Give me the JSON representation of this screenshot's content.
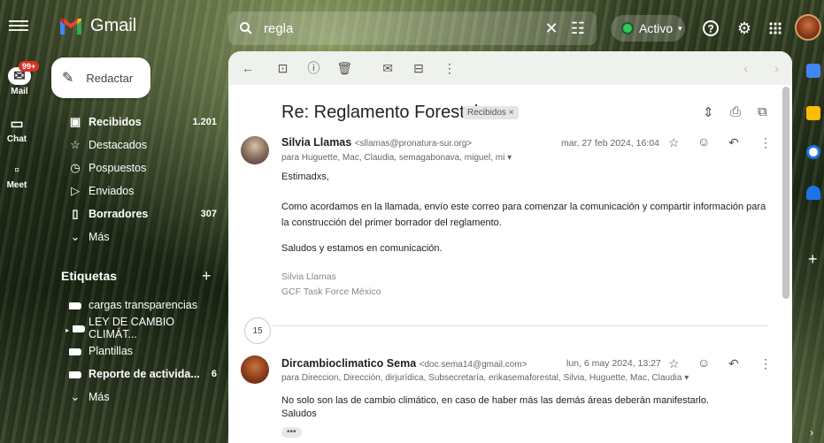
{
  "app": {
    "name": "Gmail"
  },
  "search": {
    "query": "regla"
  },
  "status": {
    "label": "Activo"
  },
  "rail": {
    "mail_label": "Mail",
    "mail_badge": "99+",
    "chat_label": "Chat",
    "meet_label": "Meet"
  },
  "compose": {
    "label": "Redactar"
  },
  "nav": [
    {
      "label": "Recibidos",
      "count": "1.201",
      "icon": "inbox-icon",
      "bold": true
    },
    {
      "label": "Destacados",
      "count": "",
      "icon": "star-icon",
      "bold": false
    },
    {
      "label": "Pospuestos",
      "count": "",
      "icon": "clock-icon",
      "bold": false
    },
    {
      "label": "Enviados",
      "count": "",
      "icon": "send-icon",
      "bold": false
    },
    {
      "label": "Borradores",
      "count": "307",
      "icon": "draft-icon",
      "bold": true
    },
    {
      "label": "Más",
      "count": "",
      "icon": "chevron-down-icon",
      "bold": false
    }
  ],
  "labels": {
    "title": "Etiquetas",
    "items": [
      {
        "label": "cargas transparencias",
        "count": "",
        "bold": false
      },
      {
        "label": "LEY DE CAMBIO CLIMÁT...",
        "count": "",
        "bold": false
      },
      {
        "label": "Plantillas",
        "count": "",
        "bold": false
      },
      {
        "label": "Reporte de activida...",
        "count": "6",
        "bold": true
      },
      {
        "label": "Más",
        "count": "",
        "bold": false
      }
    ]
  },
  "thread": {
    "subject": "Re: Reglamento Forestal",
    "chip": "Recibidos",
    "collapsed_count": "15",
    "messages": [
      {
        "sender": "Silvia Llamas",
        "email": "<sllamas@pronatura-sur.org>",
        "to": "para Huguette, Mac, Claudia, semagabonava, miguel, mi",
        "date": "mar, 27 feb 2024, 16:04",
        "greeting": "Estimadxs,",
        "body": "Como acordamos en la llamada, envío este correo para comenzar la comunicación y compartir información para la construcción del primer borrador del reglamento.",
        "closing": "Saludos y estamos en comunicación.",
        "sig_name": "Silvia Llamas",
        "sig_org": "GCF Task Force México"
      },
      {
        "sender": "Dircambioclimatico Sema",
        "email": "<doc.sema14@gmail.com>",
        "to": "para Direccion, Dirección, dirjurídica, Subsecretaría, erikasemaforestal, Silvia, Huguette, Mac, Claudia",
        "date": "lun, 6 may 2024, 13:27",
        "body": "No solo son las de cambio climático, en caso de haber más las demás áreas deberán manifestarlo.",
        "closing": "Saludos",
        "ellipsis": "•••"
      }
    ]
  },
  "colors": {
    "accent": "#d93025",
    "active": "#34c759"
  }
}
